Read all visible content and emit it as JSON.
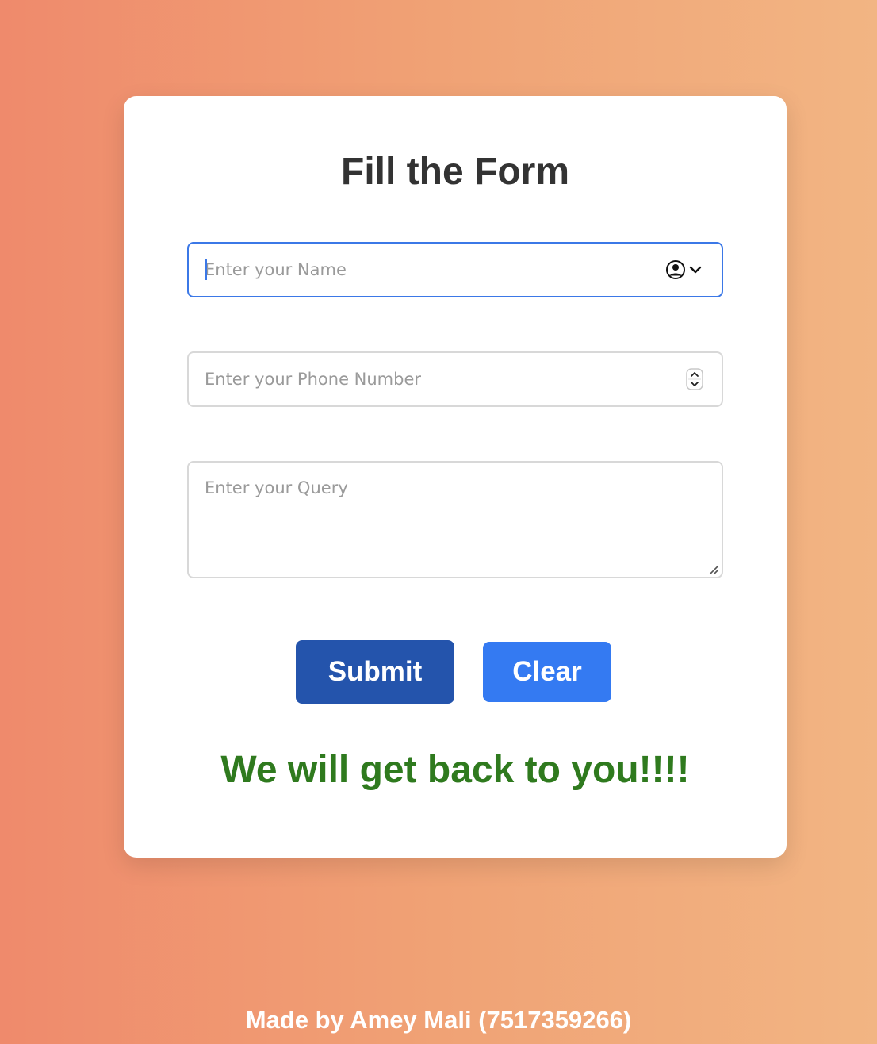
{
  "form": {
    "title": "Fill the Form",
    "name_placeholder": "Enter your Name",
    "phone_placeholder": "Enter your Phone Number",
    "query_placeholder": "Enter your Query",
    "submit_label": "Submit",
    "clear_label": "Clear",
    "message": "We will get back to you!!!!"
  },
  "footer": {
    "text": "Made by Amey Mali (7517359266)"
  },
  "icons": {
    "name_field": "contact-autofill-icon",
    "phone_field": "number-spinner-icon",
    "query_field": "resize-handle-icon"
  },
  "colors": {
    "background_start": "#EF8A6C",
    "background_end": "#F2B583",
    "card": "#FFFFFF",
    "title": "#333333",
    "focus_border": "#3B78E7",
    "submit_button": "#2454AC",
    "clear_button": "#347AF2",
    "message": "#2F7A1E",
    "footer_text": "#FFFFFF"
  }
}
